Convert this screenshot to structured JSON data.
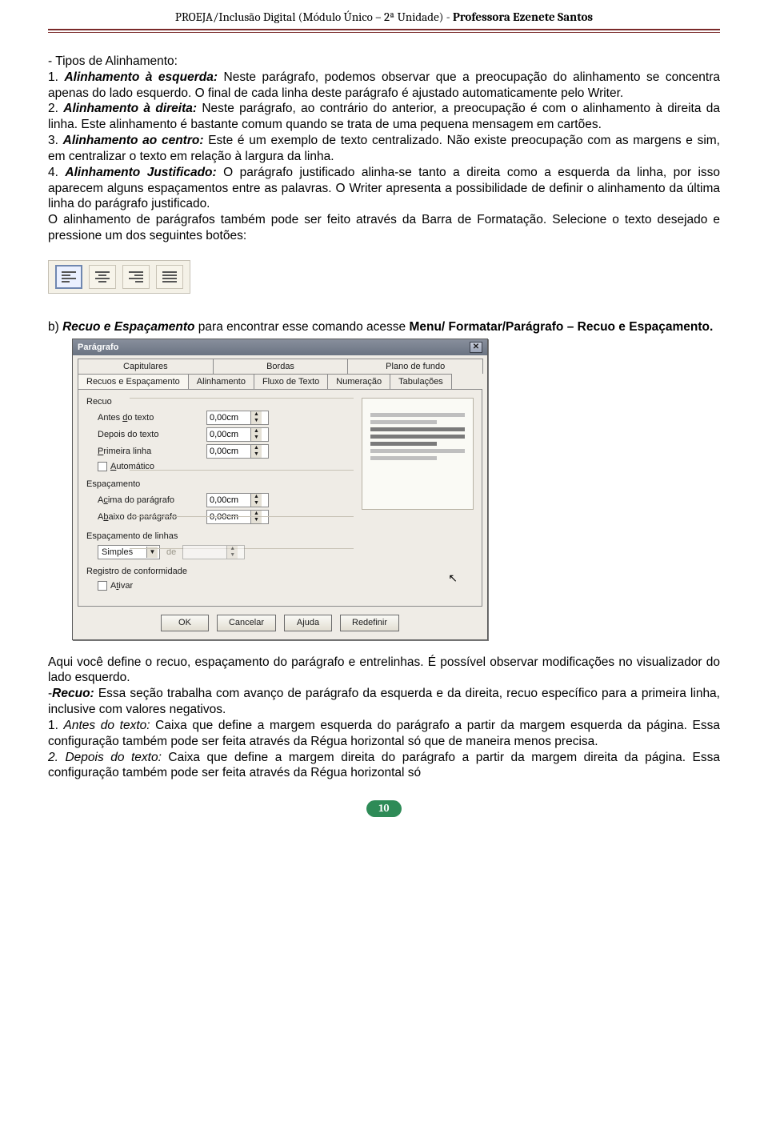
{
  "header": {
    "left": "PROEJA/Inclusão Digital (Módulo Único – 2ª Unidade) - ",
    "right": "Professora Ezenete Santos"
  },
  "text": {
    "t1": "- Tipos de Alinhamento:",
    "t2a": "1. ",
    "t2b": "Alinhamento à esquerda:",
    "t2c": " Neste parágrafo, podemos observar que a preocupação do alinhamento se concentra apenas do lado esquerdo. O final de cada linha deste parágrafo é ajustado automaticamente pelo Writer.",
    "t3a": "2. ",
    "t3b": "Alinhamento à direita:",
    "t3c": " Neste parágrafo, ao contrário do anterior, a preocupação é com o alinhamento à direita da linha. Este alinhamento é bastante comum quando se trata de uma pequena mensagem em cartões.",
    "t4a": "3. ",
    "t4b": "Alinhamento ao centro:",
    "t4c": " Este é um exemplo de texto centralizado. Não existe preocupação com as margens e sim, em centralizar o texto em relação à largura da linha.",
    "t5a": "4. ",
    "t5b": "Alinhamento Justificado:",
    "t5c": " O parágrafo justificado alinha-se tanto a direita como a esquerda da linha, por isso aparecem alguns espaçamentos entre as palavras. O Writer apresenta a possibilidade de definir o alinhamento da última linha do parágrafo justificado.",
    "t6": "O alinhamento de parágrafos também pode ser feito através da Barra de Formatação. Selecione o texto desejado e pressione um dos seguintes botões:",
    "b1a": "b) ",
    "b1b": "Recuo e Espaçamento",
    "b1c": " para encontrar esse comando acesse ",
    "b1d": "Menu/ Formatar/Parágrafo – Recuo e Espaçamento.",
    "p1": "Aqui você define o recuo, espaçamento do parágrafo e entrelinhas. É possível observar modificações no visualizador do lado esquerdo.",
    "p2a": "-",
    "p2b": "Recuo:",
    "p2c": " Essa seção trabalha com avanço de parágrafo da esquerda e da direita, recuo específico para a primeira linha, inclusive com valores negativos.",
    "p3a": "1. ",
    "p3b": "Antes do texto:",
    "p3c": " Caixa que define a margem esquerda do parágrafo a partir da margem esquerda da página. Essa configuração também pode ser feita através da Régua horizontal só que de maneira menos precisa.",
    "p4a": "2. Depois do texto:",
    "p4b": " Caixa que define a margem direita do parágrafo a partir da margem direita da página. Essa configuração também pode ser feita através da Régua horizontal só"
  },
  "toolbar": {
    "left": "align-left",
    "center": "align-center",
    "right": "align-right",
    "justify": "align-justify"
  },
  "dialog": {
    "title": "Parágrafo",
    "tabs_top": [
      "Capitulares",
      "Bordas",
      "Plano de fundo"
    ],
    "tabs_bottom": [
      "Recuos e Espaçamento",
      "Alinhamento",
      "Fluxo de Texto",
      "Numeração",
      "Tabulações"
    ],
    "group_recuo": "Recuo",
    "lbl_antes_pre": "Antes ",
    "lbl_antes_ul": "d",
    "lbl_antes_post": "o texto",
    "val_antes": "0,00cm",
    "lbl_depois": "Depois do texto",
    "val_depois": "0,00cm",
    "lbl_primeira_ul": "P",
    "lbl_primeira_post": "rimeira linha",
    "val_primeira": "0,00cm",
    "lbl_auto_ul": "A",
    "lbl_auto_post": "utomático",
    "group_esp": "Espaçamento",
    "lbl_acima_pre": "A",
    "lbl_acima_ul": "c",
    "lbl_acima_post": "ima do parágrafo",
    "val_acima": "0,00cm",
    "lbl_abaixo_pre": "A",
    "lbl_abaixo_ul": "b",
    "lbl_abaixo_post": "aixo do parágrafo",
    "val_abaixo": "0,00cm",
    "group_lin": "Espaçamento de linhas",
    "dd_value": "Simples",
    "dd_de": "de",
    "group_reg": "Registro de conformidade",
    "lbl_ativar_pre": "A",
    "lbl_ativar_ul": "t",
    "lbl_ativar_post": "ivar",
    "btn_ok": "OK",
    "btn_cancel": "Cancelar",
    "btn_help": "Ajuda",
    "btn_reset": "Redefinir"
  },
  "page_number": "10"
}
